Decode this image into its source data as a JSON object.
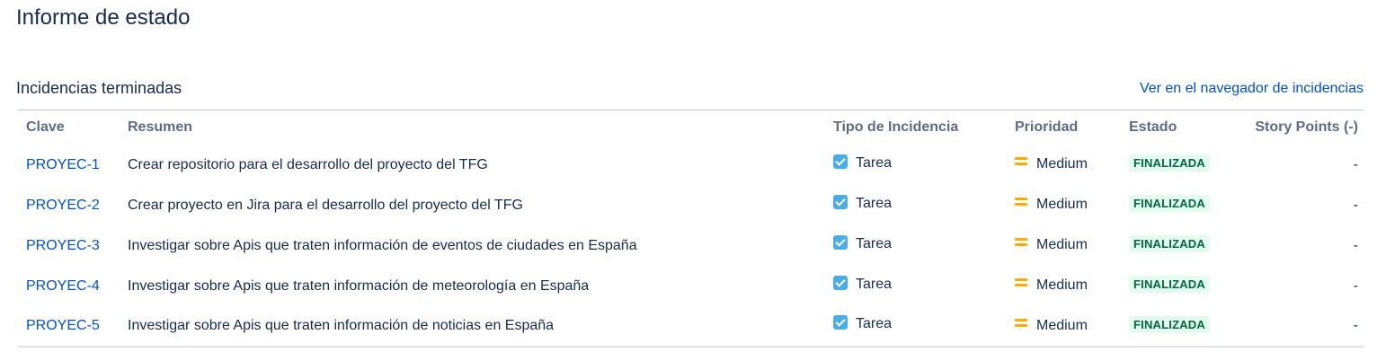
{
  "page": {
    "title": "Informe de estado"
  },
  "section": {
    "title": "Incidencias terminadas",
    "link_label": "Ver en el navegador de incidencias"
  },
  "table": {
    "headers": {
      "key": "Clave",
      "summary": "Resumen",
      "type": "Tipo de Incidencia",
      "priority": "Prioridad",
      "status": "Estado",
      "points": "Story Points (-)"
    },
    "rows": [
      {
        "key": "PROYEC-1",
        "summary": "Crear repositorio para el desarrollo del proyecto del TFG",
        "type": "Tarea",
        "type_icon": "task-checkbox-icon",
        "priority": "Medium",
        "priority_icon": "priority-medium-icon",
        "status": "FINALIZADA",
        "points": "-"
      },
      {
        "key": "PROYEC-2",
        "summary": "Crear proyecto en Jira para el desarrollo del proyecto del TFG",
        "type": "Tarea",
        "type_icon": "task-checkbox-icon",
        "priority": "Medium",
        "priority_icon": "priority-medium-icon",
        "status": "FINALIZADA",
        "points": "-"
      },
      {
        "key": "PROYEC-3",
        "summary": "Investigar sobre Apis que traten información de eventos de ciudades en España",
        "type": "Tarea",
        "type_icon": "task-checkbox-icon",
        "priority": "Medium",
        "priority_icon": "priority-medium-icon",
        "status": "FINALIZADA",
        "points": "-"
      },
      {
        "key": "PROYEC-4",
        "summary": "Investigar sobre Apis que traten información de meteorología en España",
        "type": "Tarea",
        "type_icon": "task-checkbox-icon",
        "priority": "Medium",
        "priority_icon": "priority-medium-icon",
        "status": "FINALIZADA",
        "points": "-"
      },
      {
        "key": "PROYEC-5",
        "summary": "Investigar sobre Apis que traten información de noticias en España",
        "type": "Tarea",
        "type_icon": "task-checkbox-icon",
        "priority": "Medium",
        "priority_icon": "priority-medium-icon",
        "status": "FINALIZADA",
        "points": "-"
      }
    ]
  },
  "colors": {
    "link": "#0052cc",
    "header_text": "#5e6c84",
    "task_icon": "#4bade8",
    "priority_medium": "#ffab00",
    "status_done_bg": "#e3fcef",
    "status_done_text": "#006644"
  }
}
